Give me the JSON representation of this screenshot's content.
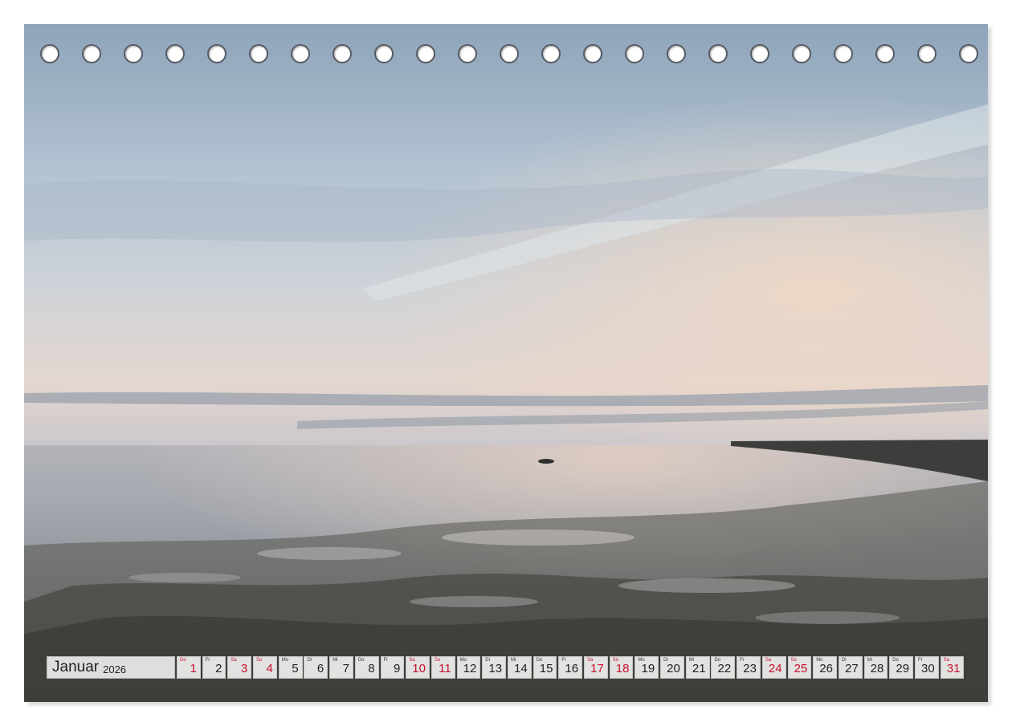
{
  "calendar": {
    "month": "Januar",
    "year": "2026",
    "weekend_color": "#c8102e",
    "days": [
      {
        "wd": "Do",
        "n": "1",
        "weekend": true
      },
      {
        "wd": "Fr",
        "n": "2",
        "weekend": false
      },
      {
        "wd": "Sa",
        "n": "3",
        "weekend": true
      },
      {
        "wd": "So",
        "n": "4",
        "weekend": true
      },
      {
        "wd": "Mo",
        "n": "5",
        "weekend": false
      },
      {
        "wd": "Di",
        "n": "6",
        "weekend": false
      },
      {
        "wd": "Mi",
        "n": "7",
        "weekend": false
      },
      {
        "wd": "Do",
        "n": "8",
        "weekend": false
      },
      {
        "wd": "Fr",
        "n": "9",
        "weekend": false
      },
      {
        "wd": "Sa",
        "n": "10",
        "weekend": true
      },
      {
        "wd": "So",
        "n": "11",
        "weekend": true
      },
      {
        "wd": "Mo",
        "n": "12",
        "weekend": false
      },
      {
        "wd": "Di",
        "n": "13",
        "weekend": false
      },
      {
        "wd": "Mi",
        "n": "14",
        "weekend": false
      },
      {
        "wd": "Do",
        "n": "15",
        "weekend": false
      },
      {
        "wd": "Fr",
        "n": "16",
        "weekend": false
      },
      {
        "wd": "Sa",
        "n": "17",
        "weekend": true
      },
      {
        "wd": "So",
        "n": "18",
        "weekend": true
      },
      {
        "wd": "Mo",
        "n": "19",
        "weekend": false
      },
      {
        "wd": "Di",
        "n": "20",
        "weekend": false
      },
      {
        "wd": "Mi",
        "n": "21",
        "weekend": false
      },
      {
        "wd": "Do",
        "n": "22",
        "weekend": false
      },
      {
        "wd": "Fr",
        "n": "23",
        "weekend": false
      },
      {
        "wd": "Sa",
        "n": "24",
        "weekend": true
      },
      {
        "wd": "So",
        "n": "25",
        "weekend": true
      },
      {
        "wd": "Mo",
        "n": "26",
        "weekend": false
      },
      {
        "wd": "Di",
        "n": "27",
        "weekend": false
      },
      {
        "wd": "Mi",
        "n": "28",
        "weekend": false
      },
      {
        "wd": "Do",
        "n": "29",
        "weekend": false
      },
      {
        "wd": "Fr",
        "n": "30",
        "weekend": false
      },
      {
        "wd": "Sa",
        "n": "31",
        "weekend": true
      }
    ]
  },
  "binding": {
    "hole_count": 23
  },
  "photo": {
    "icon": "mudflat-sunset-photo",
    "sky_top": "#8fa6bd",
    "sky_horizon": "#ead5c8",
    "water": "#a9adb3",
    "mud": "#3a3a35"
  }
}
